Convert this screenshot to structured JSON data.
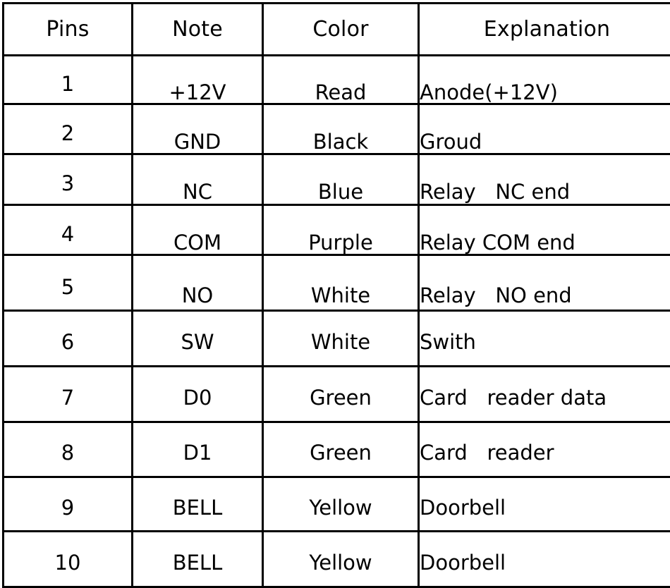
{
  "document": {
    "kind": "pin-definition-table",
    "ink_color": "#000000",
    "page_background": "#ffffff",
    "border_color": "#000000"
  },
  "table": {
    "columns": [
      {
        "key": "pins",
        "label": "Pins",
        "align": "center"
      },
      {
        "key": "note",
        "label": "Note",
        "align": "center"
      },
      {
        "key": "color",
        "label": "Color",
        "align": "center"
      },
      {
        "key": "explanation",
        "label": "Explanation",
        "align": "left"
      }
    ],
    "rows": [
      {
        "pins": "1",
        "note": "+12V",
        "color": "Read",
        "explanation": "Anode(+12V)"
      },
      {
        "pins": "2",
        "note": "GND",
        "color": "Black",
        "explanation": "Groud"
      },
      {
        "pins": "3",
        "note": "NC",
        "color": "Blue",
        "explanation": "Relay   NC end"
      },
      {
        "pins": "4",
        "note": "COM",
        "color": "Purple",
        "explanation": "Relay COM end"
      },
      {
        "pins": "5",
        "note": "NO",
        "color": "White",
        "explanation": "Relay   NO end"
      },
      {
        "pins": "6",
        "note": "SW",
        "color": "White",
        "explanation": "Swith"
      },
      {
        "pins": "7",
        "note": "D0",
        "color": "Green",
        "explanation": "Card   reader data"
      },
      {
        "pins": "8",
        "note": "D1",
        "color": "Green",
        "explanation": "Card   reader"
      },
      {
        "pins": "9",
        "note": "BELL",
        "color": "Yellow",
        "explanation": "Doorbell"
      },
      {
        "pins": "10",
        "note": "BELL",
        "color": "Yellow",
        "explanation": "Doorbell"
      }
    ]
  }
}
